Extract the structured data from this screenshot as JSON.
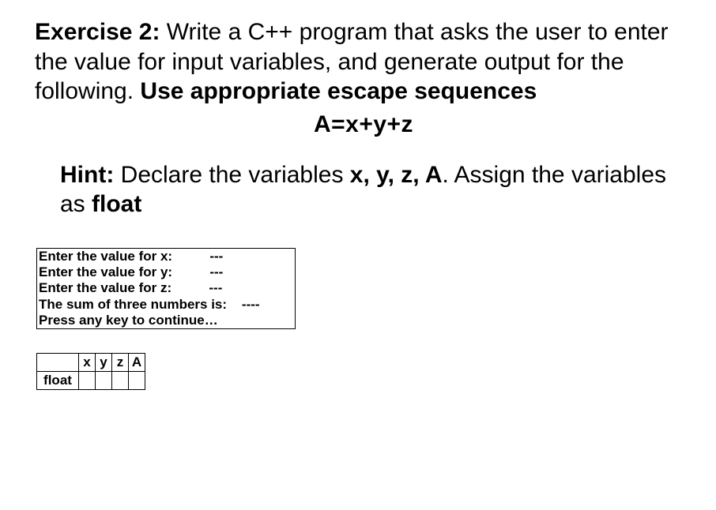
{
  "exercise": {
    "label": "Exercise 2:",
    "text_part1": " Write a C++ program that asks the user to enter the value for input variables, and generate output for the following. ",
    "text_bold_tail": "Use appropriate escape sequences"
  },
  "formula": "A=x+y+z",
  "hint": {
    "label": "Hint:",
    "text_part1": " Declare the variables ",
    "vars_bold": "x, y, z, A",
    "text_part2": ". Assign the variables as ",
    "type_bold": "float"
  },
  "output_box": {
    "line1": "Enter the value for x:          ---",
    "line2": "Enter the value for y:          ---",
    "line3": "Enter the value for z:          ---",
    "line4": "The sum of three numbers is:    ----",
    "line5": "Press any key to continue…"
  },
  "var_table": {
    "header": {
      "label_empty": "",
      "c1": "x",
      "c2": "y",
      "c3": "z",
      "c4": "A"
    },
    "row": {
      "label": "float",
      "c1": "",
      "c2": "",
      "c3": "",
      "c4": ""
    }
  }
}
